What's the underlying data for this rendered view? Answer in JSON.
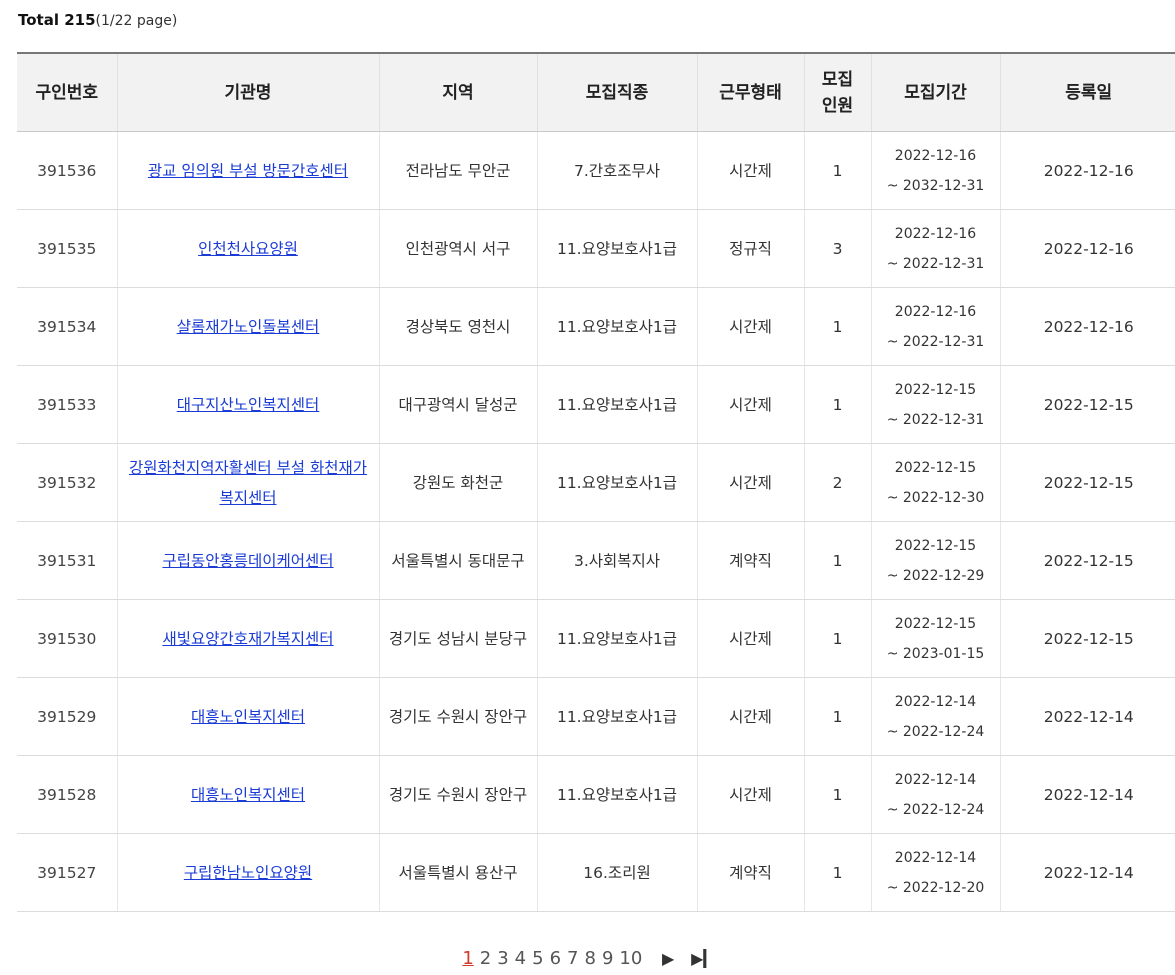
{
  "summary": {
    "total_label": "Total 215",
    "page_info": "(1/22 page)"
  },
  "table": {
    "headers": [
      "구인번호",
      "기관명",
      "지역",
      "모집직종",
      "근무형태",
      "모집\n인원",
      "모집기간",
      "등록일"
    ],
    "rows": [
      [
        "391536",
        "광교 임의원 부설 방문간호센터",
        "전라남도 무안군",
        "7.간호조무사",
        "시간제",
        "1",
        "2022-12-16\n~ 2032-12-31",
        "2022-12-16"
      ],
      [
        "391535",
        "인천천사요양원",
        "인천광역시 서구",
        "11.요양보호사1급",
        "정규직",
        "3",
        "2022-12-16\n~ 2022-12-31",
        "2022-12-16"
      ],
      [
        "391534",
        "샬롬재가노인돌봄센터",
        "경상북도 영천시",
        "11.요양보호사1급",
        "시간제",
        "1",
        "2022-12-16\n~ 2022-12-31",
        "2022-12-16"
      ],
      [
        "391533",
        "대구지산노인복지센터",
        "대구광역시 달성군",
        "11.요양보호사1급",
        "시간제",
        "1",
        "2022-12-15\n~ 2022-12-31",
        "2022-12-15"
      ],
      [
        "391532",
        "강원화천지역자활센터 부설 화천재가복지센터",
        "강원도 화천군",
        "11.요양보호사1급",
        "시간제",
        "2",
        "2022-12-15\n~ 2022-12-30",
        "2022-12-15"
      ],
      [
        "391531",
        "구립동안홍릉데이케어센터",
        "서울특별시 동대문구",
        "3.사회복지사",
        "계약직",
        "1",
        "2022-12-15\n~ 2022-12-29",
        "2022-12-15"
      ],
      [
        "391530",
        "새빛요양간호재가복지센터",
        "경기도 성남시 분당구",
        "11.요양보호사1급",
        "시간제",
        "1",
        "2022-12-15\n~ 2023-01-15",
        "2022-12-15"
      ],
      [
        "391529",
        "대흥노인복지센터",
        "경기도 수원시 장안구",
        "11.요양보호사1급",
        "시간제",
        "1",
        "2022-12-14\n~ 2022-12-24",
        "2022-12-14"
      ],
      [
        "391528",
        "대흥노인복지센터",
        "경기도 수원시 장안구",
        "11.요양보호사1급",
        "시간제",
        "1",
        "2022-12-14\n~ 2022-12-24",
        "2022-12-14"
      ],
      [
        "391527",
        "구립한남노인요양원",
        "서울특별시 용산구",
        "16.조리원",
        "계약직",
        "1",
        "2022-12-14\n~ 2022-12-20",
        "2022-12-14"
      ]
    ]
  },
  "pagination": {
    "pages": [
      "1",
      "2",
      "3",
      "4",
      "5",
      "6",
      "7",
      "8",
      "9",
      "10"
    ],
    "current": "1",
    "next_icon": "▶",
    "last_icon": "▶▎"
  }
}
